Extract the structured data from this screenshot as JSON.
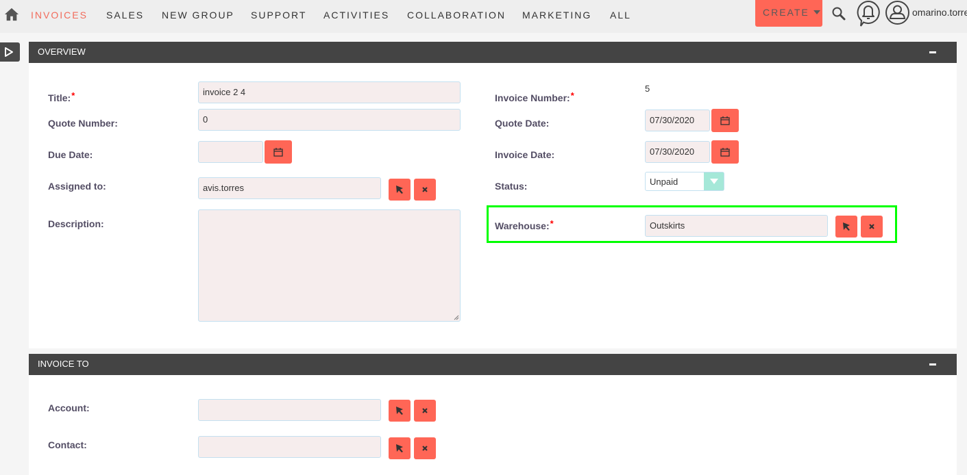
{
  "nav": {
    "items": [
      "INVOICES",
      "SALES",
      "NEW GROUP",
      "SUPPORT",
      "ACTIVITIES",
      "COLLABORATION",
      "MARKETING",
      "ALL"
    ],
    "active_index": 0,
    "create_label": "CREATE",
    "username": "omarino.torre",
    "icons": [
      "home-icon",
      "search-icon",
      "notifications-bell-icon",
      "user-avatar-icon",
      "sidebar-toggle-icon"
    ]
  },
  "overview": {
    "title": "OVERVIEW",
    "fields": {
      "title": {
        "label": "Title:",
        "required": "*",
        "value": "invoice 2 4"
      },
      "quote_number": {
        "label": "Quote Number:",
        "value": "0"
      },
      "due_date": {
        "label": "Due Date:",
        "value": ""
      },
      "assigned_to": {
        "label": "Assigned to:",
        "value": "avis.torres"
      },
      "description": {
        "label": "Description:",
        "value": ""
      },
      "invoice_number": {
        "label": "Invoice Number:",
        "required": "*",
        "value": "5"
      },
      "quote_date": {
        "label": "Quote Date:",
        "value": "07/30/2020"
      },
      "invoice_date": {
        "label": "Invoice Date:",
        "value": "07/30/2020"
      },
      "status": {
        "label": "Status:",
        "value": "Unpaid"
      },
      "warehouse": {
        "label": "Warehouse:",
        "required": "*",
        "value": "Outskirts"
      }
    }
  },
  "invoice_to": {
    "title": "INVOICE TO",
    "fields": {
      "account": {
        "label": "Account:",
        "value": ""
      },
      "contact": {
        "label": "Contact:",
        "value": ""
      }
    }
  },
  "colors": {
    "accent": "#ff6656",
    "panel_header": "#444444",
    "input_bg": "#f6eded",
    "highlight": "#00ff00",
    "select_arrow": "#a5e8d8"
  }
}
